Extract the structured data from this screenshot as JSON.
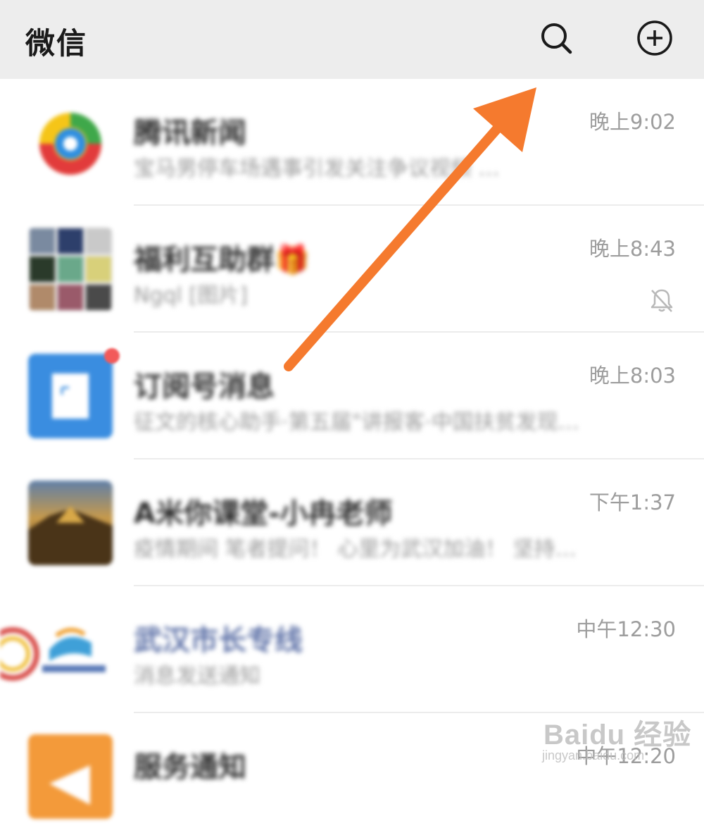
{
  "header": {
    "title": "微信",
    "search_icon": "search-icon",
    "add_icon": "plus-circle-icon"
  },
  "chats": [
    {
      "name": "腾讯新闻",
      "preview": "宝马男停车场遇事引发关注争议视频 …",
      "time": "晚上9:02",
      "avatar": "tencent-news-logo"
    },
    {
      "name": "福利互助群🎁",
      "preview": "Ngql [图片]",
      "time": "晚上8:43",
      "avatar": "group-grid-avatar",
      "muted": true
    },
    {
      "name": "订阅号消息",
      "preview": "征文的核心助手·第五届\"讲报客·中国扶贫发现…",
      "time": "晚上8:03",
      "avatar": "subscription-icon",
      "unread_dot": true
    },
    {
      "name": "A米你课堂-小冉老师",
      "preview": "疫情期间 笔者提问！ 心里为武汉加油！ 坚持…",
      "time": "下午1:37",
      "avatar": "landscape-photo"
    },
    {
      "name": "武汉市长专线",
      "preview": "消息发送通知",
      "time": "中午12:30",
      "avatar": "wuhan-hotline-logo"
    },
    {
      "name": "服务通知",
      "preview": "",
      "time": "中午12:20",
      "avatar": "service-notice-icon"
    }
  ],
  "watermark": {
    "logo": "Baidu 经验",
    "url": "jingyan.baidu.com"
  },
  "colors": {
    "header_bg": "#ededed",
    "arrow": "#f57a2e",
    "muted_text": "#9d9d9d",
    "subscription_blue": "#3a8de0",
    "service_orange": "#f39a3a"
  }
}
